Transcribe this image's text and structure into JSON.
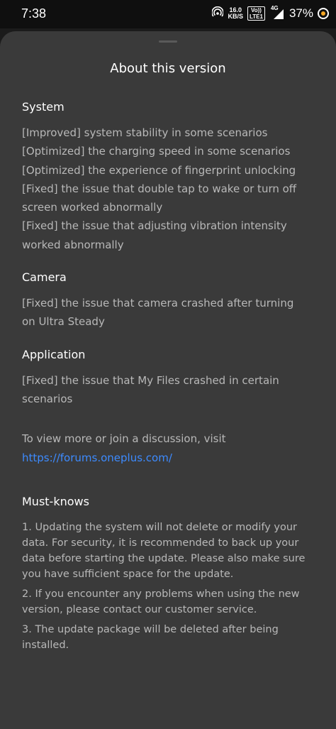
{
  "status_bar": {
    "time": "7:38",
    "net_speed_value": "16.0",
    "net_speed_unit": "KB/S",
    "volte_label_top": "Vo))",
    "volte_label_bottom": "LTE1",
    "network_type": "4G",
    "battery": "37%"
  },
  "sheet": {
    "title": "About this version",
    "sections": [
      {
        "title": "System",
        "lines": [
          "[Improved] system stability in some scenarios",
          "[Optimized] the charging speed in some scenarios",
          "[Optimized] the experience of fingerprint unlocking",
          "[Fixed] the issue that double tap to wake or turn off",
          "screen worked abnormally",
          "[Fixed] the issue that adjusting vibration intensity",
          "worked abnormally"
        ]
      },
      {
        "title": "Camera",
        "lines": [
          "[Fixed] the issue that camera crashed after turning",
          "on Ultra Steady"
        ]
      },
      {
        "title": "Application",
        "lines": [
          "[Fixed] the issue that My Files crashed in certain",
          "scenarios"
        ]
      }
    ],
    "discussion_text": "To view more or join a discussion, visit",
    "discussion_link": "https://forums.oneplus.com/",
    "must_knows": {
      "title": "Must-knows",
      "items": [
        "1. Updating the system will not delete or modify your data. For security, it is recommended to back up your data before starting the update. Please also make sure you have sufficient space for the update.",
        "2. If you encounter any problems when using the new version, please contact our customer service.",
        "3. The update package will be deleted after being installed."
      ]
    }
  },
  "colors": {
    "sheet_background": "#3a3a3a",
    "link": "#3d8bff",
    "body_text": "#b8b8b8",
    "heading_text": "#ffffff"
  }
}
